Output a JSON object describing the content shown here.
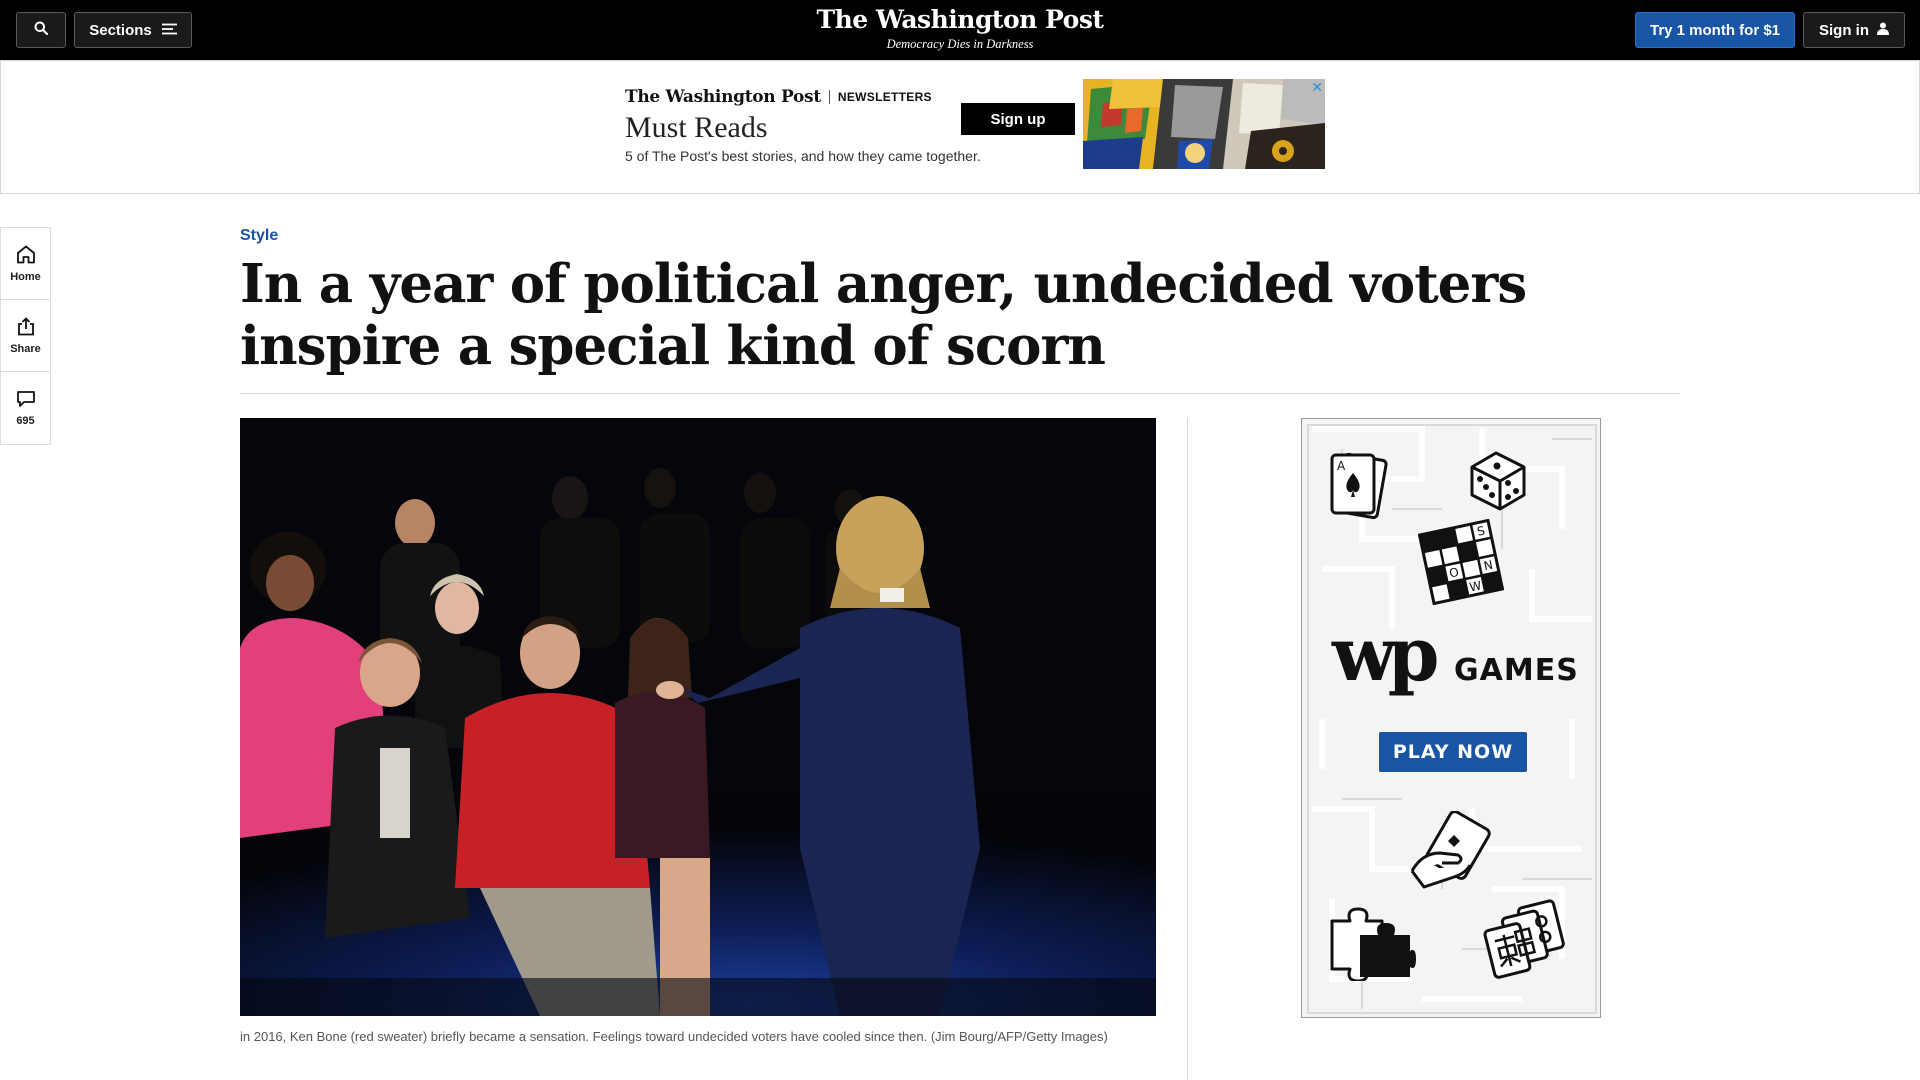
{
  "topbar": {
    "search_icon": "search-icon",
    "sections_label": "Sections",
    "masthead_title": "The Washington Post",
    "masthead_tagline": "Democracy Dies in Darkness",
    "subscribe_label": "Try 1 month for $1",
    "signin_label": "Sign in"
  },
  "banner_ad": {
    "brand": "The Washington Post",
    "section": "NEWSLETTERS",
    "title": "Must Reads",
    "subtitle": "5 of The Post's best stories, and how they came together.",
    "cta": "Sign up",
    "close_icon": "close-icon"
  },
  "rail": {
    "home_label": "Home",
    "share_label": "Share",
    "comments_count": "695"
  },
  "article": {
    "kicker": "Style",
    "headline": "In a year of political anger, undecided voters inspire a special kind of scorn",
    "caption": "in 2016, Ken Bone (red sweater) briefly became a sensation. Feelings toward undecided voters have cooled since then. (Jim Bourg/AFP/Getty Images)"
  },
  "side_ad": {
    "brand_mark": "wp",
    "title": "GAMES",
    "cta": "PLAY NOW",
    "crossword_letters": [
      "S",
      "O",
      "N",
      "W"
    ],
    "card_letter": "A"
  },
  "colors": {
    "topbar_bg": "#000000",
    "accent_blue": "#1955a5",
    "rule_gray": "#d6d6d6"
  }
}
